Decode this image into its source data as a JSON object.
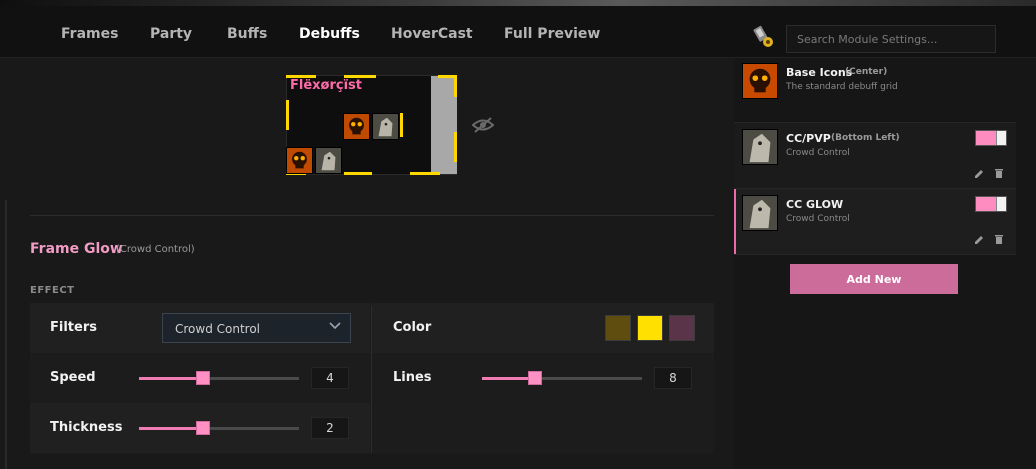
{
  "tabs": [
    {
      "label": "Frames"
    },
    {
      "label": "Party"
    },
    {
      "label": "Buffs"
    },
    {
      "label": "Debuffs"
    },
    {
      "label": "HoverCast"
    },
    {
      "label": "Full Preview"
    }
  ],
  "active_tab": "Debuffs",
  "search": {
    "placeholder": "Search Module Settings..."
  },
  "preview": {
    "unit_name": "Flëxørçïst"
  },
  "section": {
    "title": "Frame Glow",
    "subtitle": "(Crowd Control)",
    "effect_label": "EFFECT"
  },
  "settings": {
    "filters": {
      "label": "Filters",
      "value": "Crowd Control"
    },
    "color": {
      "label": "Color",
      "swatches": [
        "#5f4d10",
        "#ffe000",
        "#5a3448"
      ]
    },
    "speed": {
      "label": "Speed",
      "value": "4",
      "fraction": 0.4
    },
    "lines": {
      "label": "Lines",
      "value": "8",
      "fraction": 0.33
    },
    "thickness": {
      "label": "Thickness",
      "value": "2",
      "fraction": 0.4
    }
  },
  "modules": [
    {
      "name": "Base Icons",
      "tag": "(Center)",
      "desc": "The standard debuff grid",
      "enabled": null
    },
    {
      "name": "CC/PVP",
      "tag": "(Bottom Left)",
      "desc": "Crowd Control",
      "enabled": true
    },
    {
      "name": "CC GLOW",
      "tag": "",
      "desc": "Crowd Control",
      "enabled": true,
      "selected": true
    }
  ],
  "add_button": "Add New",
  "colors": {
    "accent": "#f06aa8",
    "glow": "#ffd800",
    "button": "#cc6c9a"
  },
  "icons": [
    "module-settings-icon",
    "eye-hidden-icon",
    "chevron-down-icon",
    "edit-icon",
    "trash-icon",
    "skull-icon",
    "horse-icon"
  ]
}
